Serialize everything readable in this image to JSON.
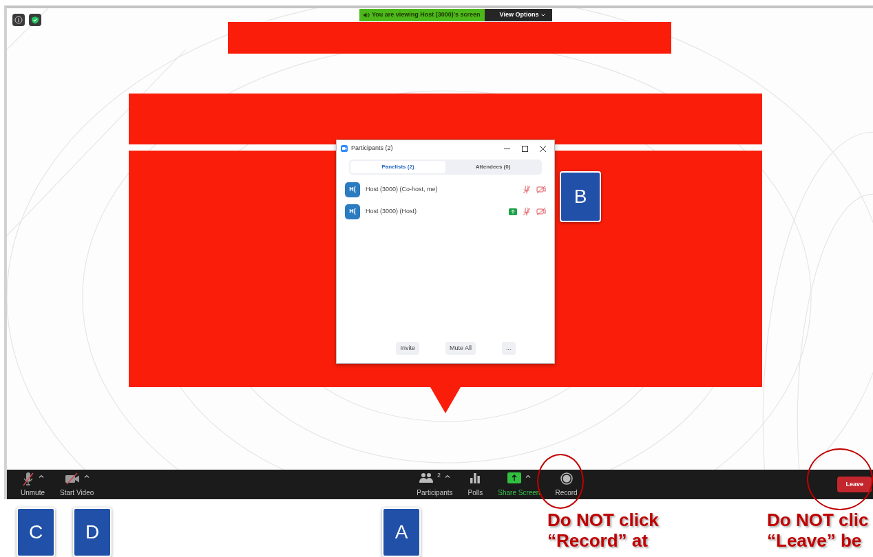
{
  "top_banner": {
    "viewing_text": "You are viewing Host (3000)'s screen",
    "view_options": "View Options"
  },
  "participants_window": {
    "title": "Participants (2)",
    "tabs": [
      {
        "label": "Panelists (2)",
        "selected": true
      },
      {
        "label": "Attendees (0)",
        "selected": false
      }
    ],
    "participants": [
      {
        "initials": "H(",
        "name": "Host (3000) (Co-host, me)",
        "sharing": false,
        "muted": true,
        "video_off": true
      },
      {
        "initials": "H(",
        "name": "Host (3000) (Host)",
        "sharing": true,
        "muted": true,
        "video_off": true
      }
    ],
    "buttons": [
      "Invite",
      "Mute All",
      "..."
    ]
  },
  "toolbar": {
    "left_items": [
      {
        "kind": "mic",
        "label": "Unmute",
        "caret": true
      },
      {
        "kind": "video",
        "label": "Start Video",
        "caret": true
      }
    ],
    "center_items": [
      {
        "kind": "participants",
        "label": "Participants",
        "count": "2",
        "caret": true
      },
      {
        "kind": "polls",
        "label": "Polls",
        "caret": false
      },
      {
        "kind": "share",
        "label": "Share Screen",
        "caret": true
      },
      {
        "kind": "record",
        "label": "Record",
        "caret": false
      }
    ],
    "leave": "Leave"
  },
  "callout_labels": [
    "B",
    "C",
    "D",
    "A"
  ],
  "warnings": [
    {
      "lines": [
        "Do NOT click",
        "“Record” at"
      ]
    },
    {
      "lines": [
        "Do NOT clic",
        "“Leave” be"
      ]
    }
  ]
}
